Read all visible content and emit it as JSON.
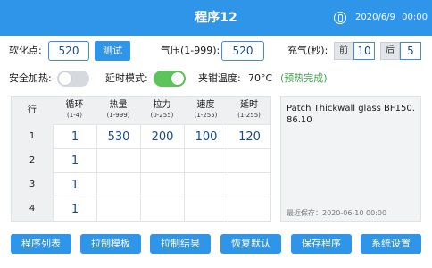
{
  "header": {
    "title": "程序12",
    "date": "2020/6/9",
    "time": "00:00",
    "icon": "thermometer-icon"
  },
  "params": {
    "soft_point_label": "软化点:",
    "soft_point_value": "520",
    "test_button": "测试",
    "pressure_label": "气压(1-999):",
    "pressure_value": "520",
    "inflate_label": "充气(秒):",
    "inflate_front_label": "前",
    "inflate_front_value": "10",
    "inflate_back_label": "后",
    "inflate_back_value": "5"
  },
  "toggles": {
    "safety_heat_label": "安全加热:",
    "safety_heat_on": false,
    "delay_mode_label": "延时模式:",
    "delay_mode_on": true,
    "clamp_temp_label": "夹钳温度:",
    "clamp_temp_value": "70°C",
    "preheat_status": "(预热完成)"
  },
  "table": {
    "row_header": "行",
    "columns": [
      {
        "name": "循环",
        "range": "(1-4)"
      },
      {
        "name": "热量",
        "range": "(1-999)"
      },
      {
        "name": "拉力",
        "range": "(0-255)"
      },
      {
        "name": "速度",
        "range": "(1-255)"
      },
      {
        "name": "延时",
        "range": "(1-255)"
      }
    ],
    "rows": [
      {
        "index": "1",
        "cells": [
          "1",
          "530",
          "200",
          "100",
          "120"
        ]
      },
      {
        "index": "2",
        "cells": [
          "1",
          "",
          "",
          "",
          ""
        ]
      },
      {
        "index": "3",
        "cells": [
          "1",
          "",
          "",
          "",
          ""
        ]
      },
      {
        "index": "4",
        "cells": [
          "1",
          "",
          "",
          "",
          ""
        ]
      }
    ]
  },
  "notes": {
    "text": "Patch Thickwall glass BF150.86.10",
    "last_saved": "最近保存：2020-06-10  00:00"
  },
  "footer": {
    "buttons": [
      "程序列表",
      "拉制模板",
      "拉制结果",
      "恢复默认",
      "保存程序",
      "系统设置"
    ]
  },
  "colors": {
    "accent": "#2f95e8",
    "value_text": "#174a8c",
    "toggle_on": "#5cc45a",
    "toggle_off": "#d6d9dd",
    "status_green": "#3ca24a"
  }
}
